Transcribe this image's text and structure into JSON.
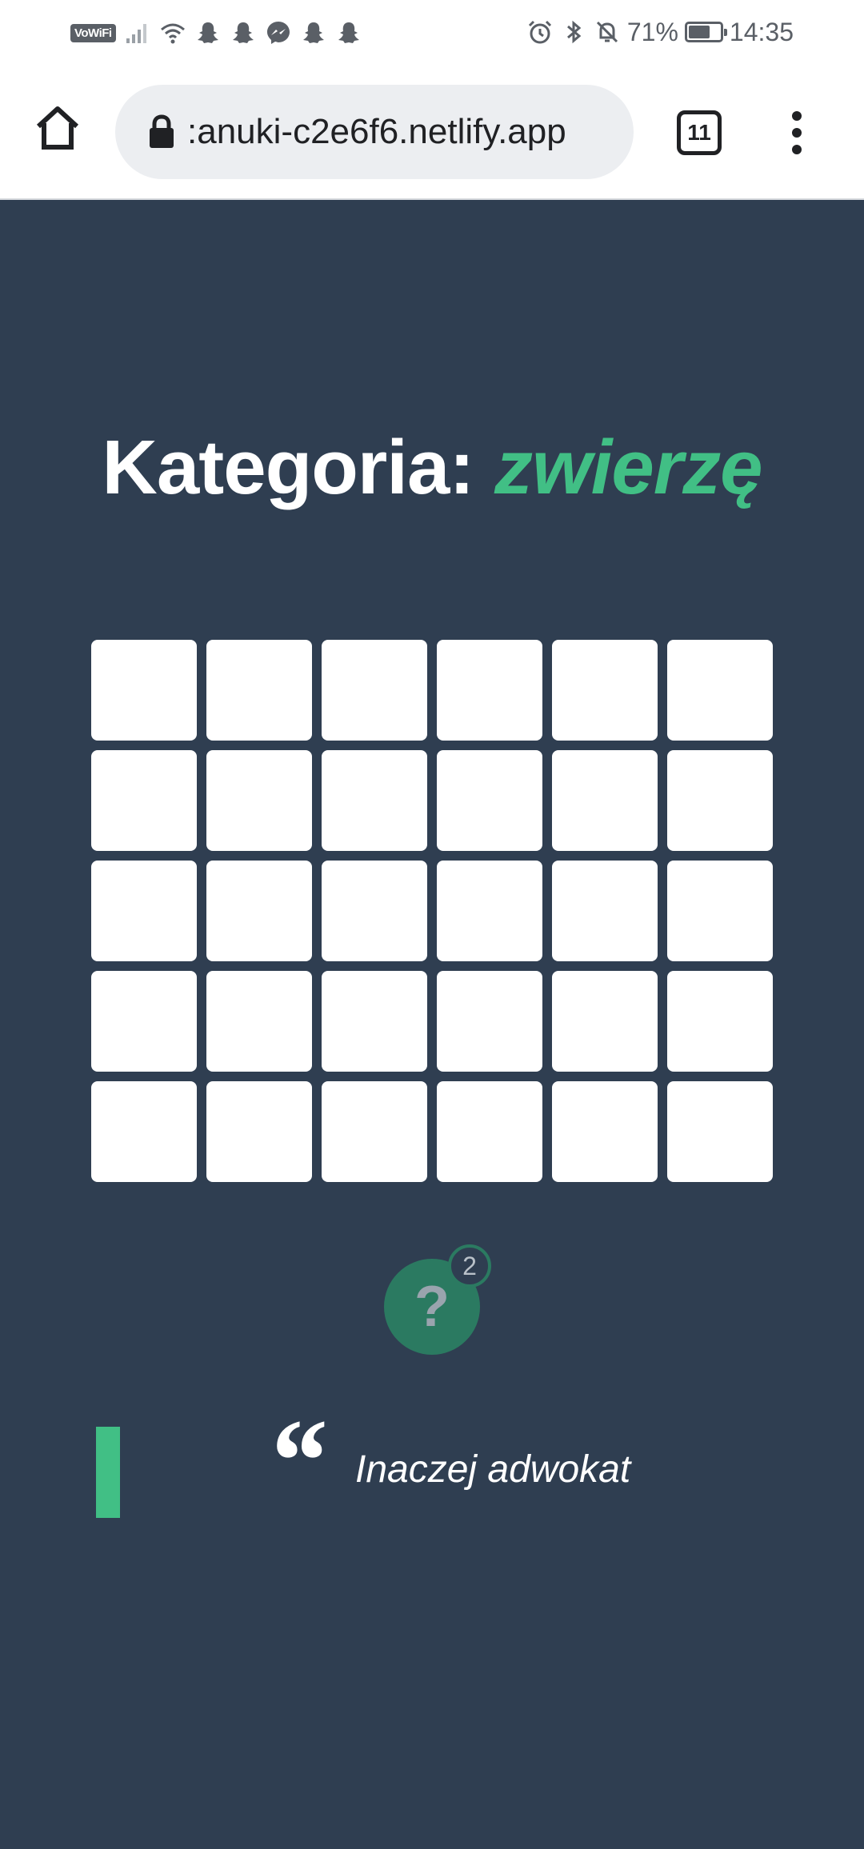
{
  "status_bar": {
    "vowifi": "VoWiFi",
    "battery_percent": "71%",
    "battery_level": 0.71,
    "time": "14:35",
    "icons": [
      "signal-icon",
      "wifi-icon",
      "snapchat-icon",
      "snapchat-icon",
      "messenger-icon",
      "snapchat-icon",
      "snapchat-icon",
      "alarm-icon",
      "bluetooth-icon",
      "mute-icon",
      "battery-icon"
    ]
  },
  "browser": {
    "url": ":anuki-c2e6f6.netlify.app",
    "tab_count": "11"
  },
  "game": {
    "title_label": "Kategoria:",
    "category": "zwierzę",
    "grid": {
      "rows": 5,
      "columns": 6,
      "cells": [
        [
          "",
          "",
          "",
          "",
          "",
          ""
        ],
        [
          "",
          "",
          "",
          "",
          "",
          ""
        ],
        [
          "",
          "",
          "",
          "",
          "",
          ""
        ],
        [
          "",
          "",
          "",
          "",
          "",
          ""
        ],
        [
          "",
          "",
          "",
          "",
          "",
          ""
        ]
      ]
    },
    "hint": {
      "symbol": "?",
      "remaining": "2"
    },
    "clue": {
      "quote_mark": "“",
      "text": "Inaczej adwokat"
    }
  },
  "colors": {
    "background": "#2f3e51",
    "accent": "#41bf85",
    "hint_button": "#2b7a61"
  }
}
